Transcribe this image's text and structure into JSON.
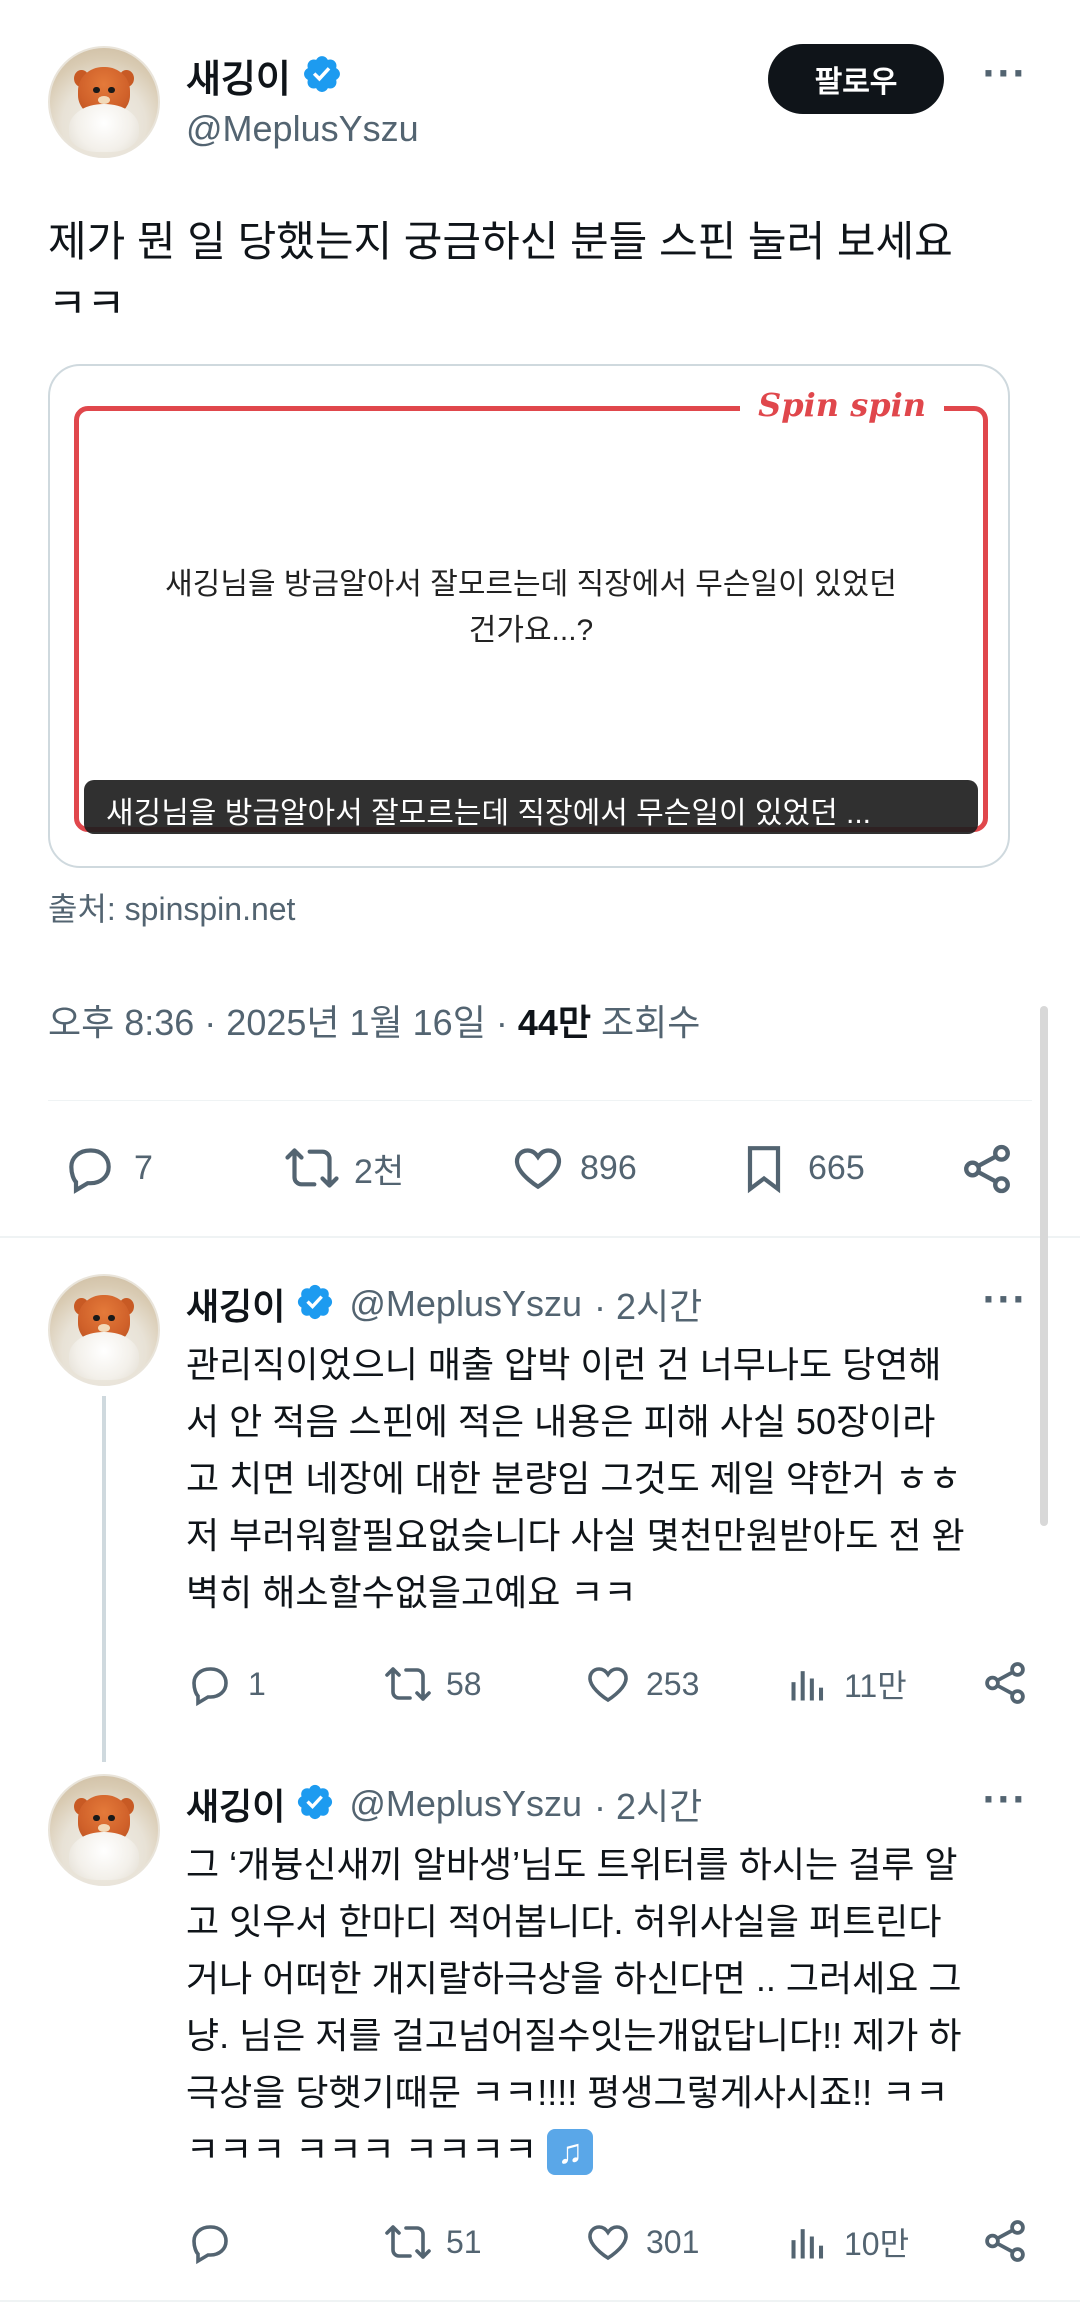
{
  "main_tweet": {
    "author_name": "새깅이",
    "author_handle": "@MeplusYszu",
    "follow_label": "팔로우",
    "text_line1": "제가 뭔 일 당했는지 궁금하신 분들 스핀 눌러 보세요",
    "text_line2": "ㅋㅋ",
    "card": {
      "brand": "Spin spin",
      "question_line1": "새깅님을 방금알아서 잘모르는데 직장에서 무슨일이 있었던",
      "question_line2": "건가요...?",
      "caption": "새깅님을 방금알아서 잘모르는데 직장에서 무슨일이 있었던 ..."
    },
    "source": "출처: spinspin.net",
    "time": "오후 8:36 · 2025년 1월 16일 · ",
    "views_count": "44만",
    "views_label": " 조회수",
    "stats": {
      "replies": "7",
      "retweets": "2천",
      "likes": "896",
      "bookmarks": "665"
    }
  },
  "replies": [
    {
      "author_name": "새깅이",
      "author_handle": "@MeplusYszu",
      "time": "· 2시간",
      "lines": [
        "관리직이었으니 매출 압박 이런 건 너무나도 당연해",
        "서 안 적음 스핀에 적은 내용은 피해 사실 50장이라",
        "고 치면 네장에 대한 분량임  그것도 제일 약한거 ㅎㅎ",
        "저 부러워할필요없슺니다 사실 몇천만원받아도 전 완",
        "벽히 해소할수없을고예요 ㅋㅋ"
      ],
      "stats": {
        "replies": "1",
        "retweets": "58",
        "likes": "253",
        "views": "11만"
      }
    },
    {
      "author_name": "새깅이",
      "author_handle": "@MeplusYszu",
      "time": "· 2시간",
      "lines": [
        "그 ‘개븅신새끼 알바생’님도 트위터를 하시는 걸루 알",
        "고 잇우서 한마디 적어봅니다. 허위사실을 퍼트린다",
        "거나 어떠한 개지랄하극상을 하신다면 .. 그러세요 그",
        "냥. 님은 저를 걸고넘어질수잇는개없답니다!! 제가 하",
        "극상을 당햇기때문 ㅋㅋ!!!! 평생그렇게사시죠!! ㅋㅋ",
        "ㅋㅋㅋ ㅋㅋㅋ ㅋㅋㅋㅋ"
      ],
      "emoji": "♫",
      "stats": {
        "replies": "",
        "retweets": "51",
        "likes": "301",
        "views": "10만"
      }
    }
  ],
  "colors": {
    "text": "#0f1419",
    "muted": "#536471",
    "verified": "#1d9bf0",
    "card_accent": "#e0474c",
    "divider": "#eff3f4"
  },
  "icons": [
    "verified-badge-icon",
    "more-icon",
    "reply-icon",
    "retweet-icon",
    "like-icon",
    "bookmark-icon",
    "share-icon",
    "views-icon",
    "music-note-icon"
  ]
}
